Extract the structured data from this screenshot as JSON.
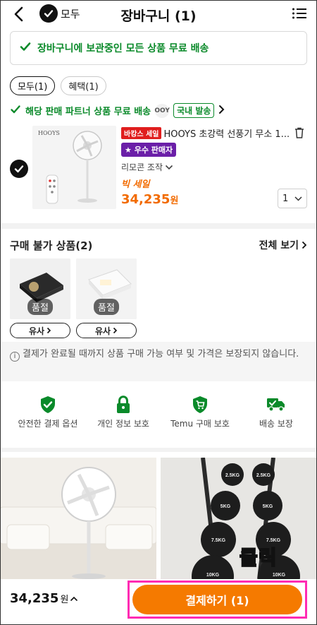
{
  "header": {
    "title": "장바구니 (1)",
    "select_all": "모두"
  },
  "banner": {
    "text": "장바구니에 보관중인 모든 상품 무료 배송"
  },
  "tabs": [
    {
      "label": "모두(1)"
    },
    {
      "label": "혜택(1)"
    }
  ],
  "partner": {
    "text": "해당 판매 파트너 상품 무료 배송",
    "logo": "OOY",
    "domestic": "국내 발송"
  },
  "product": {
    "img_brand": "HOOYS",
    "sale_badge": "바캉스 세일",
    "name": "HOOYS 초강력 선풍기 무소 1...",
    "seller_badge": "우수 판매자",
    "variant": "리모콘 조작",
    "big_sale": "빅 세일",
    "price": "34,235",
    "currency": "원",
    "qty": "1"
  },
  "unavailable": {
    "title": "구매 불가 상품(2)",
    "view_all": "전체 보기",
    "items": [
      {
        "status": "품절",
        "similar": "유사"
      },
      {
        "status": "품절",
        "similar": "유사"
      }
    ]
  },
  "notice": "결제가 완료될 때까지 상품 구매 가능 여부 및 가격은 보장되지 않습니다.",
  "guarantees": [
    {
      "label": "안전한 결제 옵션",
      "icon": "shield-check-icon"
    },
    {
      "label": "개인 정보 보호",
      "icon": "lock-icon"
    },
    {
      "label": "Temu 구매 보호",
      "icon": "cart-shield-icon"
    },
    {
      "label": "배송 보장",
      "icon": "truck-check-icon"
    }
  ],
  "recommendations": [
    {
      "image": "white-stand-fan-photo"
    },
    {
      "image": "dumbbell-rack-photo"
    }
  ],
  "overlay": {
    "click_label": "클릭"
  },
  "bottom": {
    "total": "34,235",
    "currency": "원",
    "pay_label": "결제하기 (1)"
  },
  "colors": {
    "accent": "#f57a00",
    "green": "#0a8a2a",
    "highlight": "#ff2bb3",
    "seller_purple": "#6b1fa8",
    "sale_red": "#e01e1e"
  }
}
